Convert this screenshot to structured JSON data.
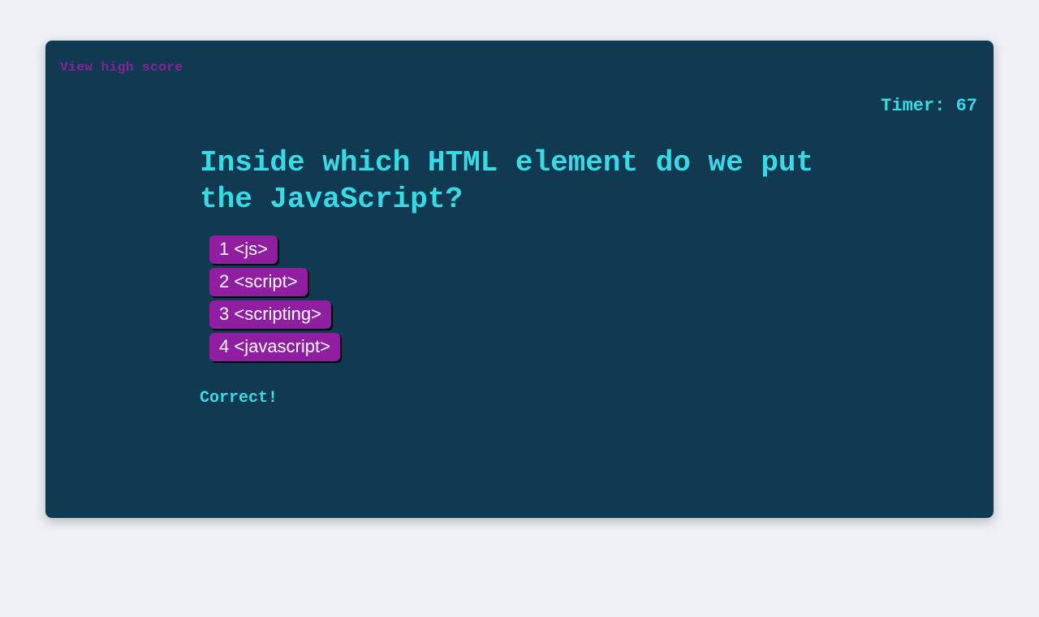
{
  "header": {
    "highscore_link": "View high score",
    "timer_label": "Timer: ",
    "timer_value": "67"
  },
  "question": "Inside which HTML element do we put the JavaScript?",
  "answers": [
    {
      "label": "1 <js>"
    },
    {
      "label": "2 <script>"
    },
    {
      "label": "3 <scripting>"
    },
    {
      "label": "4 <javascript>"
    }
  ],
  "feedback": "Correct!"
}
